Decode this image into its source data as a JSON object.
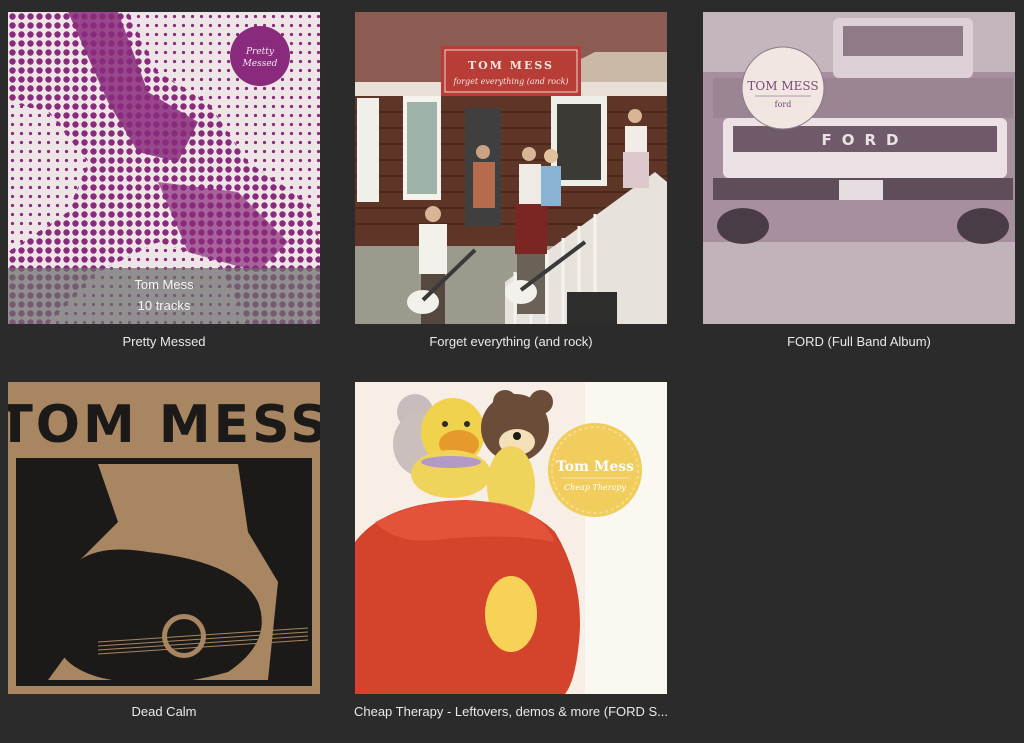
{
  "albums": [
    {
      "title": "Pretty Messed",
      "cover_text": "Pretty Messed",
      "hover": {
        "artist": "Tom Mess",
        "track_count": "10 tracks"
      }
    },
    {
      "title": "Forget everything (and rock)",
      "cover_text": {
        "artist": "TOM MESS",
        "subtitle": "forget everything (and rock)"
      }
    },
    {
      "title": "FORD (Full Band Album)",
      "cover_text": {
        "artist": "TOM MESS",
        "subtitle": "ford",
        "plate": "FORD"
      }
    },
    {
      "title": "Dead Calm",
      "cover_text": "TOM MESS"
    },
    {
      "title": "Cheap Therapy - Leftovers, demos & more (FORD S...",
      "cover_text": {
        "artist": "Tom Mess",
        "subtitle": "Cheap Therapy"
      }
    }
  ],
  "colors": {
    "background": "#2b2b2b",
    "title_text": "#e9e9e9",
    "magenta": "#8a2a7c",
    "tan": "#a88661",
    "cream": "#f2e8d6"
  }
}
